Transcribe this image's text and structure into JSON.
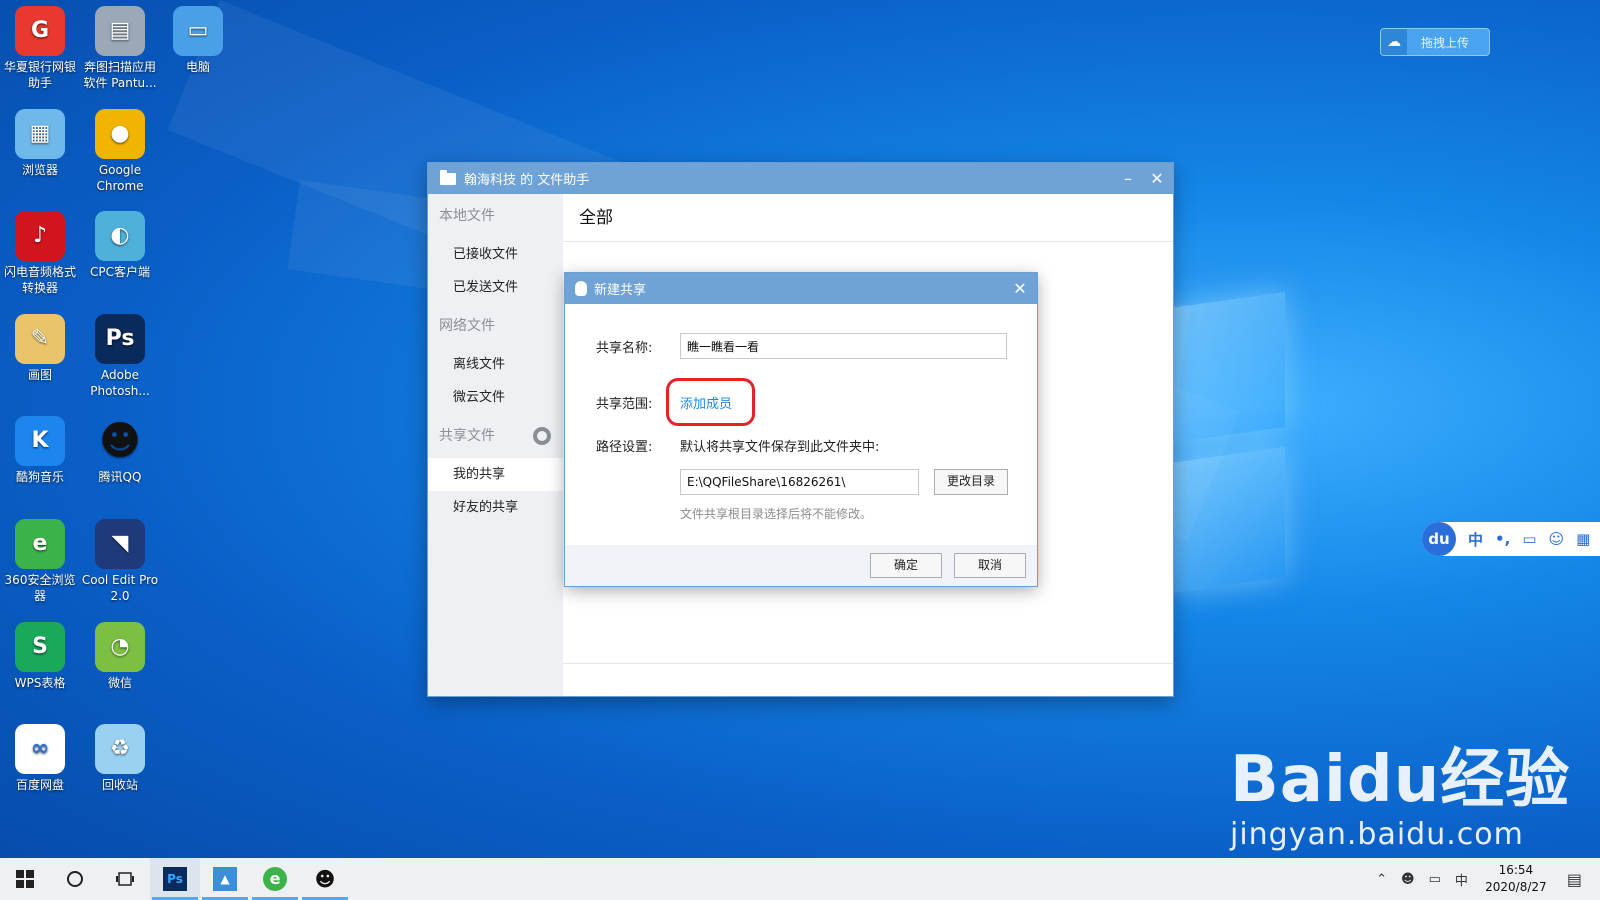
{
  "desktop": {
    "icons": [
      {
        "label": "华夏银行网银助手",
        "glyph": "G",
        "color": "#e8382f"
      },
      {
        "label": "奔图扫描应用软件 Pantu...",
        "glyph": "▤",
        "color": "#9aa8b8"
      },
      {
        "label": "电脑",
        "glyph": "▭",
        "color": "#4aa0e6"
      },
      {
        "label": "浏览器",
        "glyph": "▦",
        "color": "#6fb8ea"
      },
      {
        "label": "Google Chrome",
        "glyph": "●",
        "color": "#f2b400"
      },
      {
        "label": "闪电音频格式转换器",
        "glyph": "♪",
        "color": "#d2141e"
      },
      {
        "label": "CPC客户端",
        "glyph": "◐",
        "color": "#4fb0d9"
      },
      {
        "label": "画图",
        "glyph": "✎",
        "color": "#e9c46a"
      },
      {
        "label": "Adobe Photosh...",
        "glyph": "Ps",
        "color": "#0a2a5c"
      },
      {
        "label": "酷狗音乐",
        "glyph": "K",
        "color": "#1c86ee"
      },
      {
        "label": "腾讯QQ",
        "glyph": "☻",
        "color": "#111111"
      },
      {
        "label": "360安全浏览器",
        "glyph": "e",
        "color": "#3cb34a"
      },
      {
        "label": "Cool Edit Pro 2.0",
        "glyph": "◥",
        "color": "#1e3a7a"
      },
      {
        "label": "WPS表格",
        "glyph": "S",
        "color": "#1aa85a"
      },
      {
        "label": "微信",
        "glyph": "◔",
        "color": "#7bc043"
      },
      {
        "label": "百度网盘",
        "glyph": "∞",
        "color": "#ffffff"
      },
      {
        "label": "回收站",
        "glyph": "♻",
        "color": "#9ad0f0"
      }
    ]
  },
  "main_window": {
    "title": "翰海科技 的 文件助手",
    "minimize": "–",
    "close": "✕",
    "sidebar": {
      "local_header": "本地文件",
      "received": "已接收文件",
      "sent": "已发送文件",
      "network_header": "网络文件",
      "offline": "离线文件",
      "weiyun": "微云文件",
      "share_header": "共享文件",
      "my_share": "我的共享",
      "friend_share": "好友的共享"
    },
    "content_title": "全部"
  },
  "dialog": {
    "title": "新建共享",
    "close": "✕",
    "name_label": "共享名称:",
    "name_value": "瞧一瞧看一看",
    "scope_label": "共享范围:",
    "add_member": "添加成员",
    "path_label": "路径设置:",
    "path_desc": "默认将共享文件保存到此文件夹中:",
    "path_value": "E:\\QQFileShare\\16826261\\",
    "change_dir": "更改目录",
    "path_hint": "文件共享根目录选择后将不能修改。",
    "ok": "确定",
    "cancel": "取消"
  },
  "upload_widget": {
    "label": "拖拽上传"
  },
  "ime": {
    "logo": "du",
    "lang": "中",
    "punct": "•,",
    "items": [
      "▭",
      "☺",
      "▦"
    ]
  },
  "watermark": {
    "brand": "Bai",
    "brand_du": "du",
    "suffix": "经验",
    "url": "jingyan.baidu.com"
  },
  "taskbar": {
    "apps": [
      "Ps",
      "▲",
      "e",
      "☻"
    ],
    "clock_time": "16:54",
    "clock_date": "2020/8/27",
    "tray_lang": "中"
  }
}
